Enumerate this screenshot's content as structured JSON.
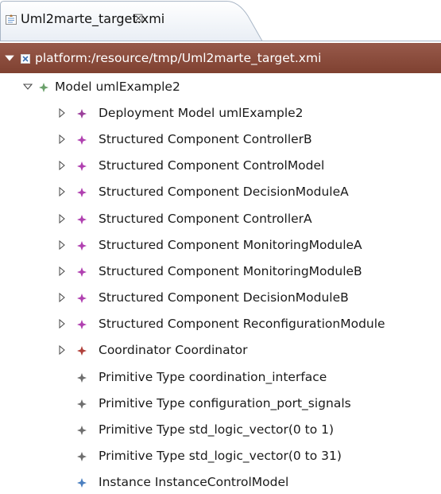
{
  "editor_tab": {
    "title": "Uml2marte_target.xmi",
    "close_glyph": "☒"
  },
  "tree": {
    "root": {
      "label": "platform:/resource/tmp/Uml2marte_target.xmi",
      "icon": "xmi-file-icon",
      "expanded": true
    },
    "model": {
      "label": "Model umlExample2",
      "icon": "model-icon",
      "expanded": true
    },
    "children": [
      {
        "label": "Deployment Model umlExample2",
        "icon": "deployment-model-icon",
        "expandable": true,
        "color": "#9b3f9b"
      },
      {
        "label": "Structured Component ControllerB",
        "icon": "structured-component-icon",
        "expandable": true,
        "color": "#b040b0"
      },
      {
        "label": "Structured Component ControlModel",
        "icon": "structured-component-icon",
        "expandable": true,
        "color": "#b040b0"
      },
      {
        "label": "Structured Component DecisionModuleA",
        "icon": "structured-component-icon",
        "expandable": true,
        "color": "#b040b0"
      },
      {
        "label": "Structured Component ControllerA",
        "icon": "structured-component-icon",
        "expandable": true,
        "color": "#b040b0"
      },
      {
        "label": "Structured Component MonitoringModuleA",
        "icon": "structured-component-icon",
        "expandable": true,
        "color": "#b040b0"
      },
      {
        "label": "Structured Component MonitoringModuleB",
        "icon": "structured-component-icon",
        "expandable": true,
        "color": "#b040b0"
      },
      {
        "label": "Structured Component DecisionModuleB",
        "icon": "structured-component-icon",
        "expandable": true,
        "color": "#b040b0"
      },
      {
        "label": "Structured Component ReconfigurationModule",
        "icon": "structured-component-icon",
        "expandable": true,
        "color": "#b040b0"
      },
      {
        "label": "Coordinator Coordinator",
        "icon": "coordinator-icon",
        "expandable": true,
        "color": "#b0403a"
      },
      {
        "label": "Primitive Type coordination_interface",
        "icon": "primitive-type-icon",
        "expandable": false,
        "color": "#6e6e6e"
      },
      {
        "label": "Primitive Type configuration_port_signals",
        "icon": "primitive-type-icon",
        "expandable": false,
        "color": "#6e6e6e"
      },
      {
        "label": "Primitive Type std_logic_vector(0 to 1)",
        "icon": "primitive-type-icon",
        "expandable": false,
        "color": "#6e6e6e"
      },
      {
        "label": "Primitive Type std_logic_vector(0 to 31)",
        "icon": "primitive-type-icon",
        "expandable": false,
        "color": "#6e6e6e"
      },
      {
        "label": "Instance InstanceControlModel",
        "icon": "instance-icon",
        "expandable": false,
        "color": "#4a7fc0"
      }
    ]
  },
  "colors": {
    "selection": "#8a4f3a",
    "model_icon": "#6aa06a"
  }
}
